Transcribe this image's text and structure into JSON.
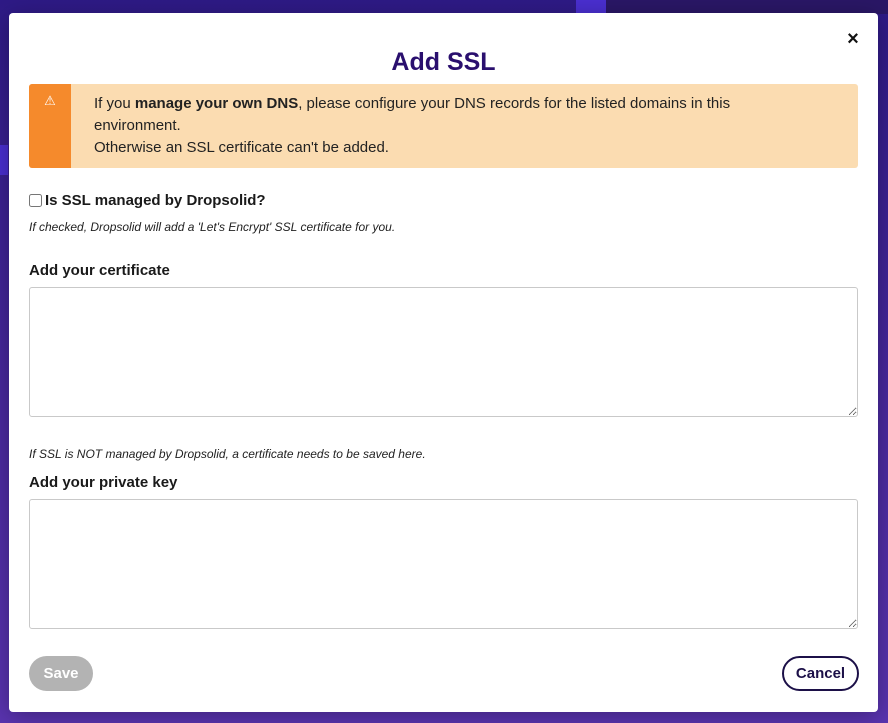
{
  "modal": {
    "title": "Add SSL",
    "close_label": "×"
  },
  "alert": {
    "icon": "warning-icon",
    "icon_glyph": "⚠",
    "text_prefix": "If you ",
    "text_bold": "manage your own DNS",
    "text_suffix": ", please configure your DNS records for the listed domains in this environment.",
    "text_line2": "Otherwise an SSL certificate can't be added.",
    "colors": {
      "bar": "#f58a2c",
      "background": "#fbdcb1"
    }
  },
  "ssl_managed": {
    "label": "Is SSL managed by Dropsolid?",
    "checked": false,
    "help": "If checked, Dropsolid will add a 'Let's Encrypt' SSL certificate for you."
  },
  "certificate": {
    "label": "Add your certificate",
    "value": "",
    "help": "If SSL is NOT managed by Dropsolid, a certificate needs to be saved here."
  },
  "private_key": {
    "label": "Add your private key",
    "value": ""
  },
  "actions": {
    "save_label": "Save",
    "cancel_label": "Cancel"
  },
  "colors": {
    "title": "#2a0f6e",
    "backdrop": "#3a1f8a",
    "save_disabled": "#b3b3b3",
    "cancel_border": "#1c1048"
  }
}
